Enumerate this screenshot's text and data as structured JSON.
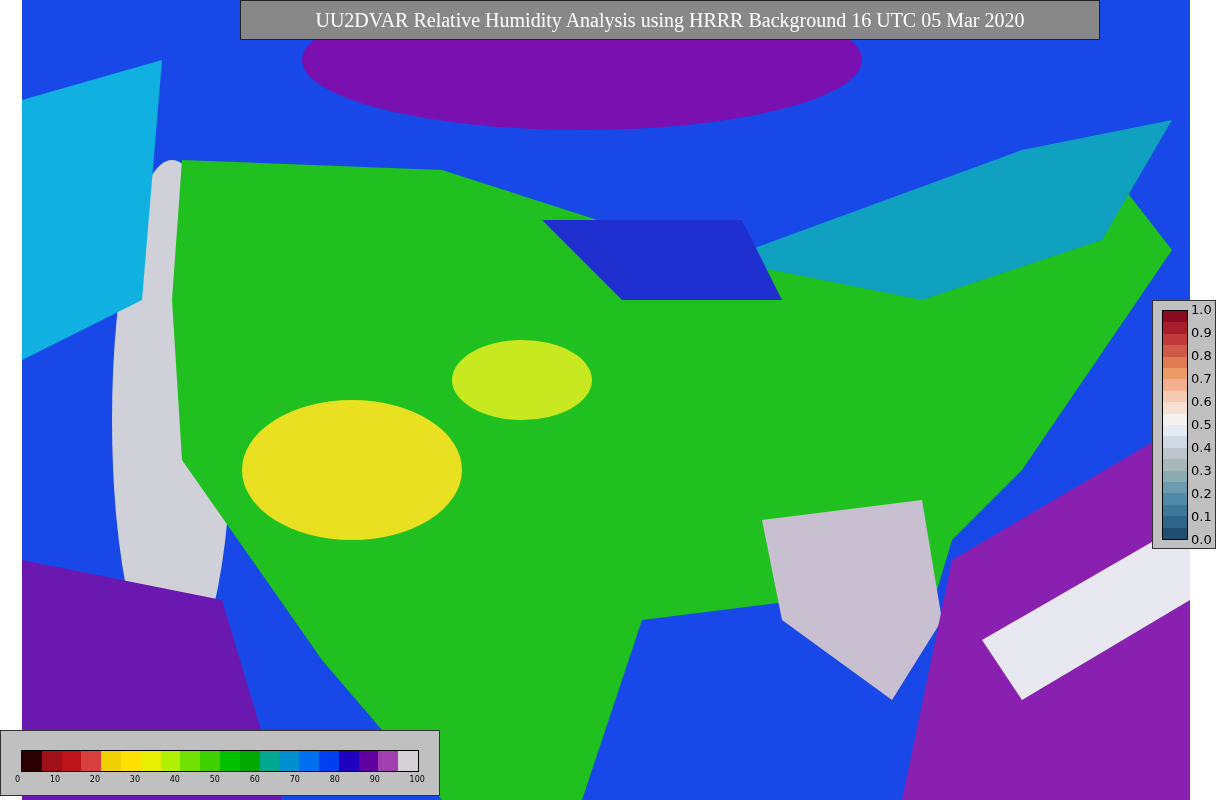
{
  "title": "UU2DVAR Relative Humidity Analysis using HRRR Background 16 UTC 05 Mar 2020",
  "right_colorbar": {
    "labels": [
      "1.0",
      "0.9",
      "0.8",
      "0.7",
      "0.6",
      "0.5",
      "0.4",
      "0.3",
      "0.2",
      "0.1",
      "0.0"
    ],
    "segments": [
      {
        "color": "#1f4e70"
      },
      {
        "color": "#2d6488"
      },
      {
        "color": "#3d7898"
      },
      {
        "color": "#4f8aa8"
      },
      {
        "color": "#6c9aae"
      },
      {
        "color": "#8aabb0"
      },
      {
        "color": "#a6b8b8"
      },
      {
        "color": "#bcc6cc"
      },
      {
        "color": "#d0dae4"
      },
      {
        "color": "#e4ecf2"
      },
      {
        "color": "#f4f2f0"
      },
      {
        "color": "#f8e0d4"
      },
      {
        "color": "#f6cbb4"
      },
      {
        "color": "#f2b090"
      },
      {
        "color": "#ec9a66"
      },
      {
        "color": "#e07a50"
      },
      {
        "color": "#d05a48"
      },
      {
        "color": "#c03a3a"
      },
      {
        "color": "#a81e2c"
      },
      {
        "color": "#8a0c20"
      }
    ]
  },
  "bottom_colorbar": {
    "labels": [
      "0",
      "10",
      "20",
      "30",
      "40",
      "50",
      "60",
      "70",
      "80",
      "90",
      "100"
    ],
    "segments": [
      {
        "color": "#2a0000"
      },
      {
        "color": "#a01018"
      },
      {
        "color": "#c0141c"
      },
      {
        "color": "#d84040"
      },
      {
        "color": "#f0d000"
      },
      {
        "color": "#ffe000"
      },
      {
        "color": "#e8f000"
      },
      {
        "color": "#b0f000"
      },
      {
        "color": "#70e000"
      },
      {
        "color": "#40d000"
      },
      {
        "color": "#00c000"
      },
      {
        "color": "#00a800"
      },
      {
        "color": "#00a890"
      },
      {
        "color": "#0090d0"
      },
      {
        "color": "#0070f0"
      },
      {
        "color": "#0040f0"
      },
      {
        "color": "#2000c0"
      },
      {
        "color": "#6000a0"
      },
      {
        "color": "#a040b0"
      },
      {
        "color": "#d8d0d8"
      }
    ]
  }
}
